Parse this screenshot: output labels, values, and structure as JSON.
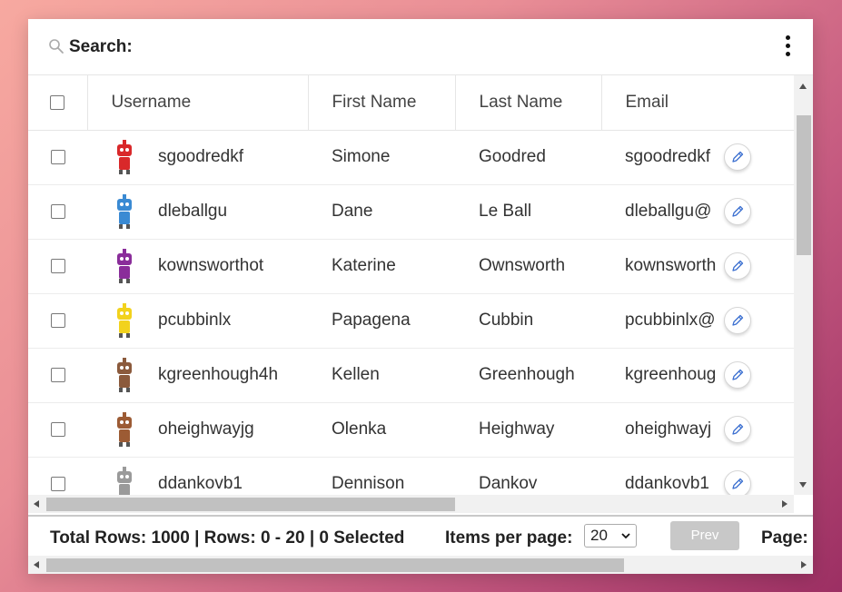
{
  "toolbar": {
    "search_label": "Search:"
  },
  "columns": [
    "Username",
    "First Name",
    "Last Name",
    "Email"
  ],
  "rows": [
    {
      "username": "sgoodredkf",
      "first": "Simone",
      "last": "Goodred",
      "email": "sgoodredkf",
      "avatar_color": "#d9282a"
    },
    {
      "username": "dleballgu",
      "first": "Dane",
      "last": "Le Ball",
      "email": "dleballgu@",
      "avatar_color": "#3a8ad3"
    },
    {
      "username": "kownsworthot",
      "first": "Katerine",
      "last": "Ownsworth",
      "email": "kownsworth",
      "avatar_color": "#8a2d9a"
    },
    {
      "username": "pcubbinlx",
      "first": "Papagena",
      "last": "Cubbin",
      "email": "pcubbinlx@",
      "avatar_color": "#f2d21d"
    },
    {
      "username": "kgreenhough4h",
      "first": "Kellen",
      "last": "Greenhough",
      "email": "kgreenhoug",
      "avatar_color": "#8b5a3c"
    },
    {
      "username": "oheighwayjg",
      "first": "Olenka",
      "last": "Heighway",
      "email": "oheighwayj",
      "avatar_color": "#9c5b34"
    },
    {
      "username": "ddankovb1",
      "first": "Dennison",
      "last": "Dankov",
      "email": "ddankovb1",
      "avatar_color": "#9a9a9a"
    }
  ],
  "footer": {
    "total_text": "Total Rows: 1000 | Rows: 0 - 20 | 0 Selected",
    "items_per_page_label": "Items per page:",
    "items_per_page_value": "20",
    "prev_label": "Prev",
    "page_label": "Page:"
  },
  "colors": {
    "accent_edit": "#3b6fd0"
  }
}
